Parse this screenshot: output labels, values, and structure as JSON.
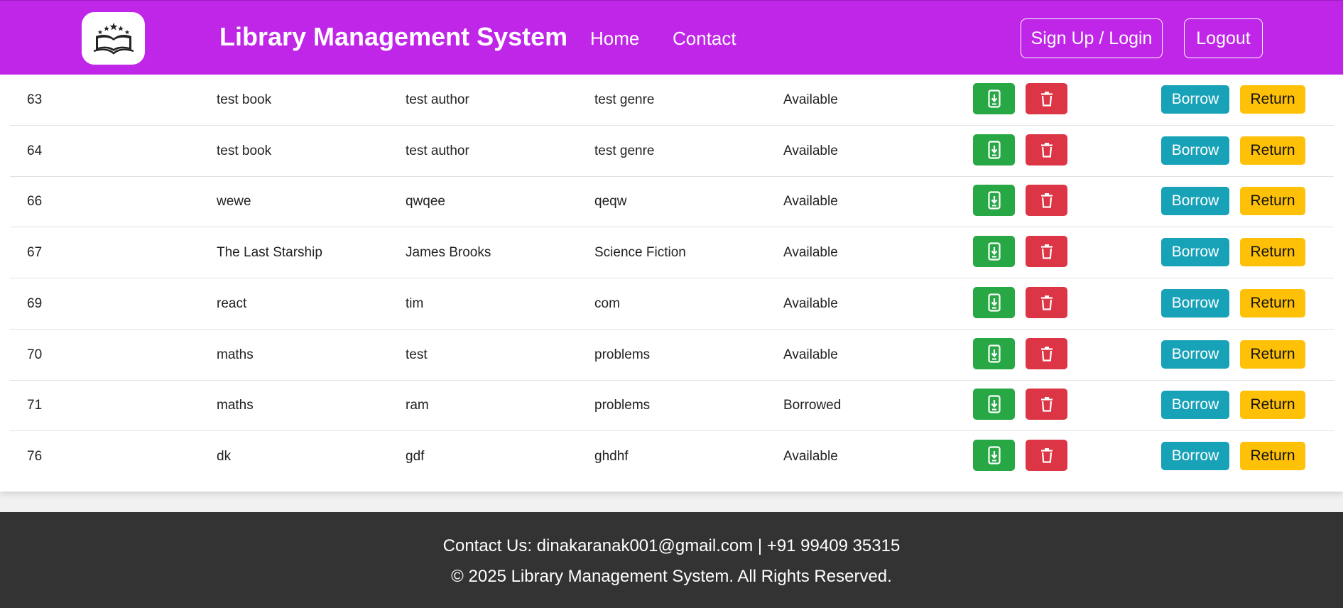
{
  "header": {
    "title": "Library Management System",
    "nav": [
      "Home",
      "Contact"
    ],
    "signup_label": "Sign Up / Login",
    "logout_label": "Logout",
    "logo_icon": "open-book-stars-icon",
    "bg_color": "#c026e8"
  },
  "books": [
    {
      "id": "63",
      "title": "test book",
      "author": "test author",
      "genre": "test genre",
      "status": "Available"
    },
    {
      "id": "64",
      "title": "test book",
      "author": "test author",
      "genre": "test genre",
      "status": "Available"
    },
    {
      "id": "66",
      "title": "wewe",
      "author": "qwqee",
      "genre": "qeqw",
      "status": "Available"
    },
    {
      "id": "67",
      "title": "The Last Starship",
      "author": "James Brooks",
      "genre": "Science Fiction",
      "status": "Available"
    },
    {
      "id": "69",
      "title": "react",
      "author": "tim",
      "genre": "com",
      "status": "Available"
    },
    {
      "id": "70",
      "title": "maths",
      "author": "test",
      "genre": "problems",
      "status": "Available"
    },
    {
      "id": "71",
      "title": "maths",
      "author": "ram",
      "genre": "problems",
      "status": "Borrowed"
    },
    {
      "id": "76",
      "title": "dk",
      "author": "gdf",
      "genre": "ghdhf",
      "status": "Available"
    }
  ],
  "row_actions": {
    "borrow_label": "Borrow",
    "return_label": "Return",
    "download_icon": "phone-download-icon",
    "delete_icon": "trash-icon",
    "colors": {
      "download": "#28a745",
      "delete": "#dc3545",
      "borrow": "#17a2b8",
      "return": "#ffc107"
    }
  },
  "footer": {
    "contact": "Contact Us: dinakaranak001@gmail.com | +91 99409 35315",
    "copyright": "© 2025 Library Management System. All Rights Reserved."
  }
}
